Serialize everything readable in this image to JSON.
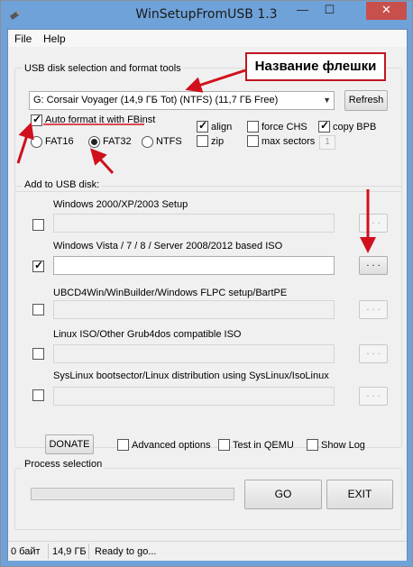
{
  "window": {
    "title": "WinSetupFromUSB 1.3",
    "minimize": "—",
    "maximize": "☐",
    "close": "✕"
  },
  "menu": [
    "File",
    "Help"
  ],
  "disk_group": {
    "label": "USB disk selection and format tools",
    "selected_disk": "G: Corsair Voyager (14,9 ГБ Tot) (NTFS) (11,7 ГБ Free)",
    "refresh": "Refresh",
    "auto_format": {
      "label": "Auto format it with FBinst",
      "checked": true
    },
    "fat16": "FAT16",
    "fat32": "FAT32",
    "ntfs": "NTFS",
    "selected_fs": "FAT32",
    "align": {
      "label": "align",
      "checked": true
    },
    "zip": {
      "label": "zip",
      "checked": false
    },
    "force_chs": {
      "label": "force CHS",
      "checked": false
    },
    "max_sectors": {
      "label": "max sectors",
      "checked": false
    },
    "copy_bpb": {
      "label": "copy BPB",
      "checked": true
    },
    "spin_value": "1"
  },
  "add_group": {
    "label": "Add to USB disk:",
    "items": [
      {
        "label": "Windows 2000/XP/2003 Setup",
        "checked": false,
        "browse": ". . ."
      },
      {
        "label": "Windows Vista / 7 / 8 / Server 2008/2012 based ISO",
        "checked": true,
        "browse": ". . ."
      },
      {
        "label": "UBCD4Win/WinBuilder/Windows FLPC setup/BartPE",
        "checked": false,
        "browse": ". . ."
      },
      {
        "label": "Linux ISO/Other Grub4dos compatible ISO",
        "checked": false,
        "browse": ". . ."
      },
      {
        "label": "SysLinux bootsector/Linux distribution using SysLinux/IsoLinux",
        "checked": false,
        "browse": ". . ."
      }
    ]
  },
  "options": {
    "donate": "DONATE",
    "advanced": "Advanced options",
    "test_qemu": "Test in QEMU",
    "show_log": "Show Log"
  },
  "process": {
    "label": "Process selection",
    "go": "GO",
    "exit": "EXIT",
    "progress": 0
  },
  "status": {
    "free": "0 байт",
    "total": "14,9 ГБ",
    "message": "Ready to go..."
  },
  "annotation": {
    "callout_text": "Название флешки",
    "color": "#d0101d"
  }
}
